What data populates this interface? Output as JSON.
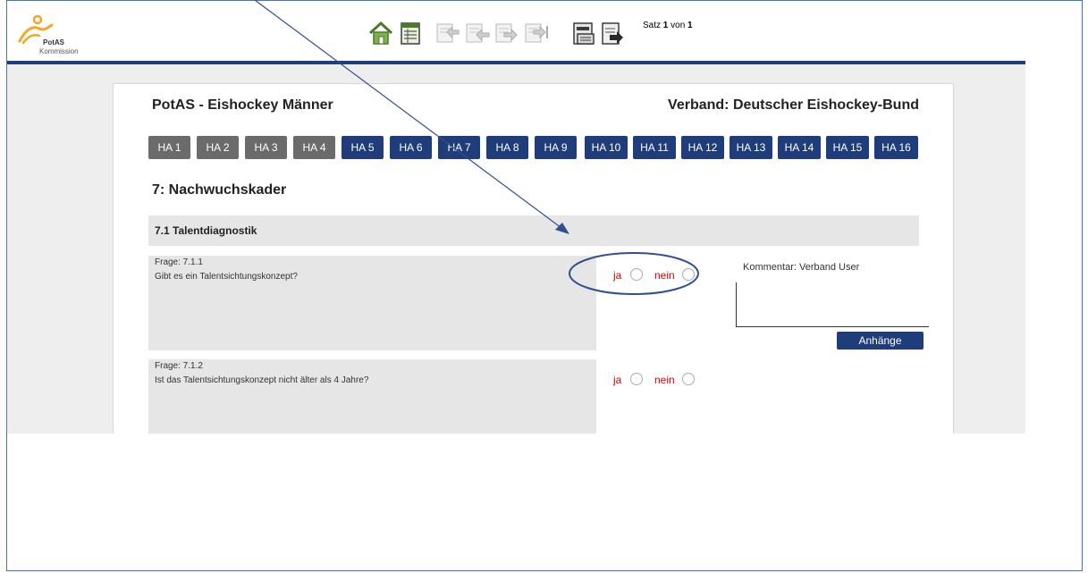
{
  "logo": {
    "brand": "PotAS",
    "sub": "Kommission"
  },
  "toolbar": {
    "buttons": [
      {
        "icon": "home-icon"
      },
      {
        "icon": "table-icon"
      },
      {
        "icon": "first-record-icon"
      },
      {
        "icon": "previous-record-icon"
      },
      {
        "icon": "next-record-icon"
      },
      {
        "icon": "last-record-icon"
      },
      {
        "icon": "print-icon"
      },
      {
        "icon": "exit-icon"
      }
    ],
    "record": {
      "prefix": "Satz",
      "current": "1",
      "sep": "von",
      "total": "1"
    }
  },
  "header": {
    "title": "PotAS - Eishockey Männer",
    "verband": "Verband: Deutscher Eishockey-Bund"
  },
  "tabs": [
    {
      "label": "HA 1",
      "state": "done"
    },
    {
      "label": "HA 2",
      "state": "done"
    },
    {
      "label": "HA 3",
      "state": "done"
    },
    {
      "label": "HA 4",
      "state": "done"
    },
    {
      "label": "HA 5",
      "state": "active"
    },
    {
      "label": "HA 6",
      "state": "active"
    },
    {
      "label": "HA 7",
      "state": "active"
    },
    {
      "label": "HA 8",
      "state": "active"
    },
    {
      "label": "HA 9",
      "state": "active"
    },
    {
      "label": "HA 10",
      "state": "active"
    },
    {
      "label": "HA 11",
      "state": "active"
    },
    {
      "label": "HA 12",
      "state": "active"
    },
    {
      "label": "HA 13",
      "state": "active"
    },
    {
      "label": "HA 14",
      "state": "active"
    },
    {
      "label": "HA 15",
      "state": "active"
    },
    {
      "label": "HA 16",
      "state": "active"
    }
  ],
  "section": {
    "title": "7: Nachwuchskader",
    "subsection": "7.1 Talentdiagnostik"
  },
  "questions": [
    {
      "number": "Frage: 7.1.1",
      "text": "Gibt es ein Talentsichtungskonzept?",
      "yes": "ja",
      "no": "nein",
      "comment_label": "Kommentar: Verband User",
      "attach_label": "Anhänge"
    },
    {
      "number": "Frage: 7.1.2",
      "text": "Ist das Talentsichtungskonzept nicht älter als 4 Jahre?",
      "yes": "ja",
      "no": "nein"
    }
  ],
  "colors": {
    "primary": "#1f3d7a",
    "tab_done": "#6b6b6b",
    "answer_red": "#e00000",
    "annotation": "#2f4f8f"
  }
}
